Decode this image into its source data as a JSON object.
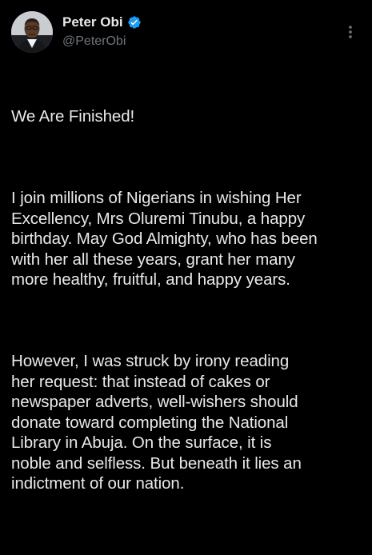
{
  "tweet": {
    "author": {
      "display_name": "Peter Obi",
      "handle": "@PeterObi",
      "verified": true,
      "verified_color": "#1d9bf0"
    },
    "menu_icon": "more-vertical-icon",
    "paragraphs": [
      "We Are Finished!",
      "I join millions of Nigerians in wishing Her\nExcellency, Mrs Oluremi Tinubu, a happy\nbirthday. May God Almighty, who has been\nwith her all these years, grant her many\nmore healthy, fruitful, and happy years.",
      "However, I was struck by irony reading\nher request: that instead of cakes or\nnewspaper adverts, well-wishers should\ndonate toward completing the National\nLibrary in Abuja. On the surface, it is\nnoble and selfless. But beneath it lies an\nindictment of our nation."
    ]
  },
  "theme": {
    "background": "#000000",
    "text": "#e7e9ea",
    "secondary_text": "#71767b"
  }
}
